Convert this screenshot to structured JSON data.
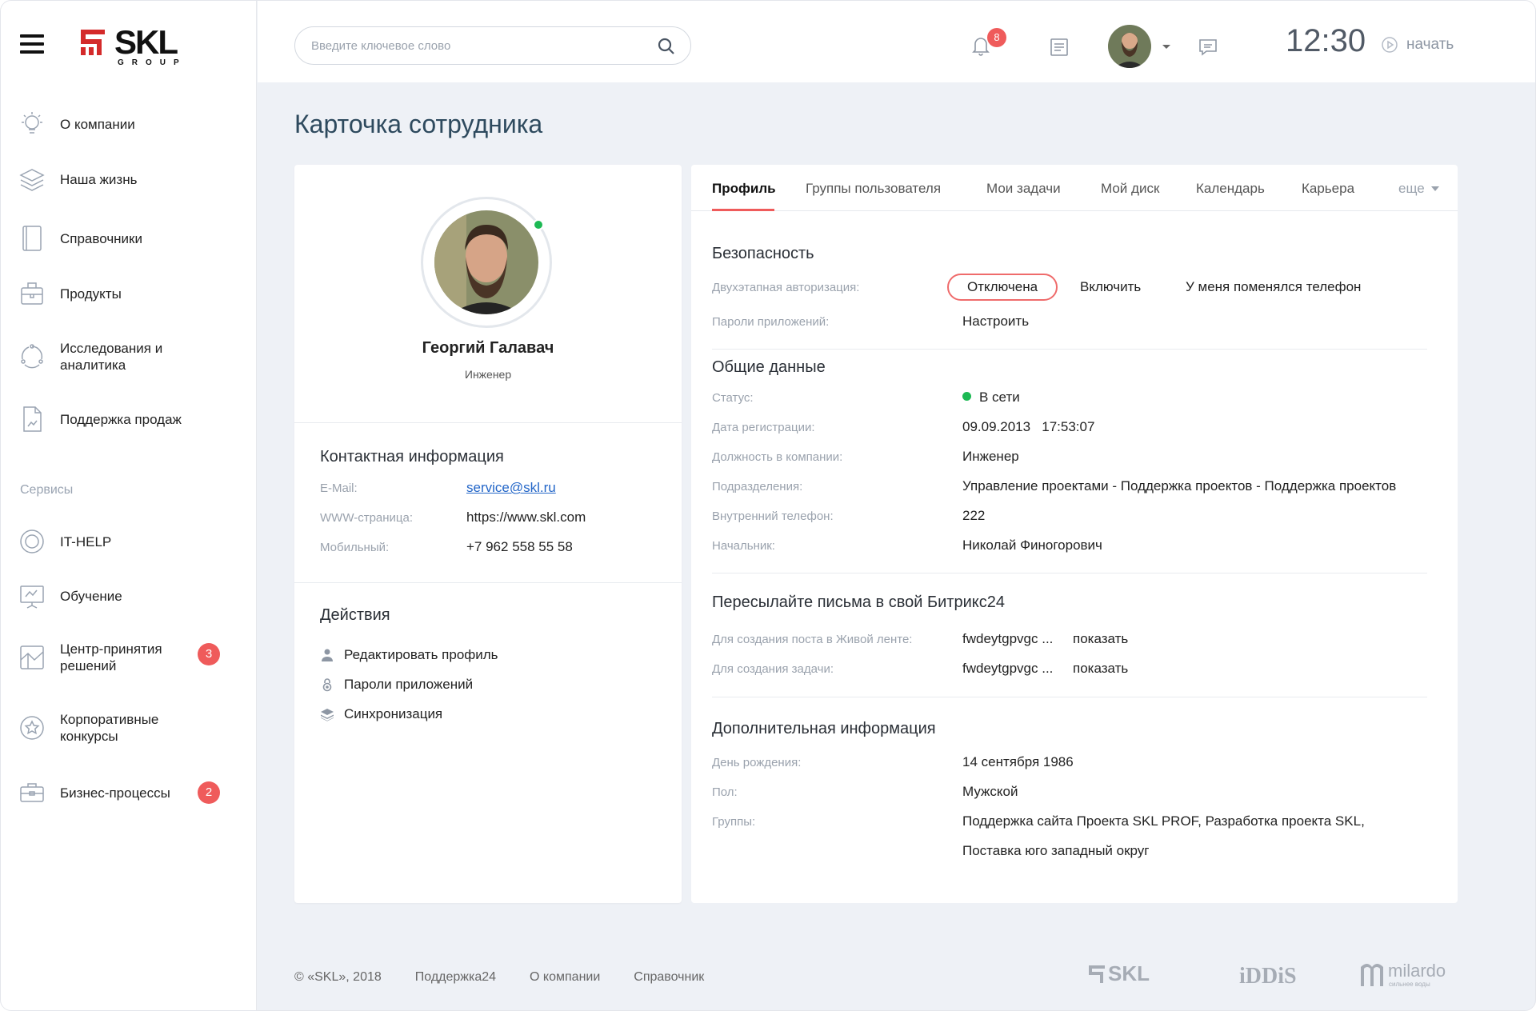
{
  "brand": {
    "word": "SKL",
    "sub": "GROUP",
    "accent": "#d42a2a"
  },
  "sidebar": {
    "items": [
      {
        "label": "О компании",
        "icon": "bulb-icon"
      },
      {
        "label": "Наша жизнь",
        "icon": "layers-icon"
      },
      {
        "label": "Справочники",
        "icon": "book-icon"
      },
      {
        "label": "Продукты",
        "icon": "package-icon"
      },
      {
        "label": "Исследования и аналитика",
        "icon": "cycle-icon"
      },
      {
        "label": "Поддержка продаж",
        "icon": "document-chart-icon"
      }
    ],
    "section": "Сервисы",
    "services": [
      {
        "label": "IT-HELP",
        "icon": "lifebuoy-icon"
      },
      {
        "label": "Обучение",
        "icon": "presentation-icon"
      },
      {
        "label": "Центр-принятия решений",
        "icon": "decision-map-icon",
        "badge": "3"
      },
      {
        "label": "Корпоративные конкурсы",
        "icon": "star-icon"
      },
      {
        "label": "Бизнес-процессы",
        "icon": "briefcase-icon",
        "badge": "2"
      }
    ]
  },
  "topbar": {
    "search_placeholder": "Введите ключевое слово",
    "notifications_count": "8",
    "clock": "12:30",
    "start_label": "начать"
  },
  "page": {
    "title": "Карточка сотрудника"
  },
  "profile": {
    "name": "Георгий Галавач",
    "role": "Инженер",
    "online": true,
    "contact": {
      "title": "Контактная информация",
      "rows": [
        {
          "key": "E-Mail:",
          "value": "service@skl.ru"
        },
        {
          "key": "WWW-страница:",
          "value": "https://www.skl.com"
        },
        {
          "key": "Мобильный:",
          "value": "+7 962 558 55 58"
        }
      ]
    },
    "actions": {
      "title": "Действия",
      "items": [
        {
          "label": "Редактировать профиль",
          "icon": "user-icon"
        },
        {
          "label": "Пароли приложений",
          "icon": "lock-icon"
        },
        {
          "label": "Синхронизация",
          "icon": "stack-icon"
        }
      ]
    }
  },
  "tabs": {
    "items": [
      "Профиль",
      "Группы пользователя",
      "Мои задачи",
      "Мой диск",
      "Календарь",
      "Карьера"
    ],
    "more": "еще",
    "active": 0
  },
  "security": {
    "title": "Безопасность",
    "twofa_key": "Двухэтапная авторизация:",
    "twofa_state": "Отключена",
    "enable": "Включить",
    "phone_changed": "У меня поменялся телефон",
    "app_passwords_key": "Пароли приложений:",
    "configure": "Настроить"
  },
  "general": {
    "title": "Общие данные",
    "rows": [
      {
        "key": "Статус:",
        "value": "В сети"
      },
      {
        "key": "Дата регистрации:",
        "value": "09.09.2013   17:53:07"
      },
      {
        "key": "Должность в компании:",
        "value": "Инженер"
      },
      {
        "key": "Подразделения:",
        "value": "Управление проектами - Поддержка проектов - Поддержка проектов"
      },
      {
        "key": "Внутренний телефон:",
        "value": "222"
      },
      {
        "key": "Начальник:",
        "value": "Николай Финогорович"
      }
    ]
  },
  "forward": {
    "title": "Пересылайте письма в свой Битрикс24",
    "rows": [
      {
        "key": "Для создания поста в Живой ленте:",
        "value": "fwdeytgpvgc ...",
        "link": "показать"
      },
      {
        "key": "Для создания задачи:",
        "value": "fwdeytgpvgc ...",
        "link": "показать"
      }
    ]
  },
  "additional": {
    "title": "Дополнительная информация",
    "birthday_key": "День рождения:",
    "birthday": "14 сентября 1986",
    "gender_key": "Пол:",
    "gender": "Мужской",
    "groups_key": "Группы:",
    "groups_line1": "Поддержка сайта Проекта SKL PROF, Разработка проекта SKL,",
    "groups_line2": "Поставка юго западный округ"
  },
  "footer": {
    "copyright": "© «SKL», 2018",
    "links": [
      "Поддержка24",
      "О компании",
      "Справочник"
    ],
    "partners": [
      "SKL",
      "iDDiS",
      "milardo"
    ],
    "milardo_tagline": "сильнее воды"
  }
}
